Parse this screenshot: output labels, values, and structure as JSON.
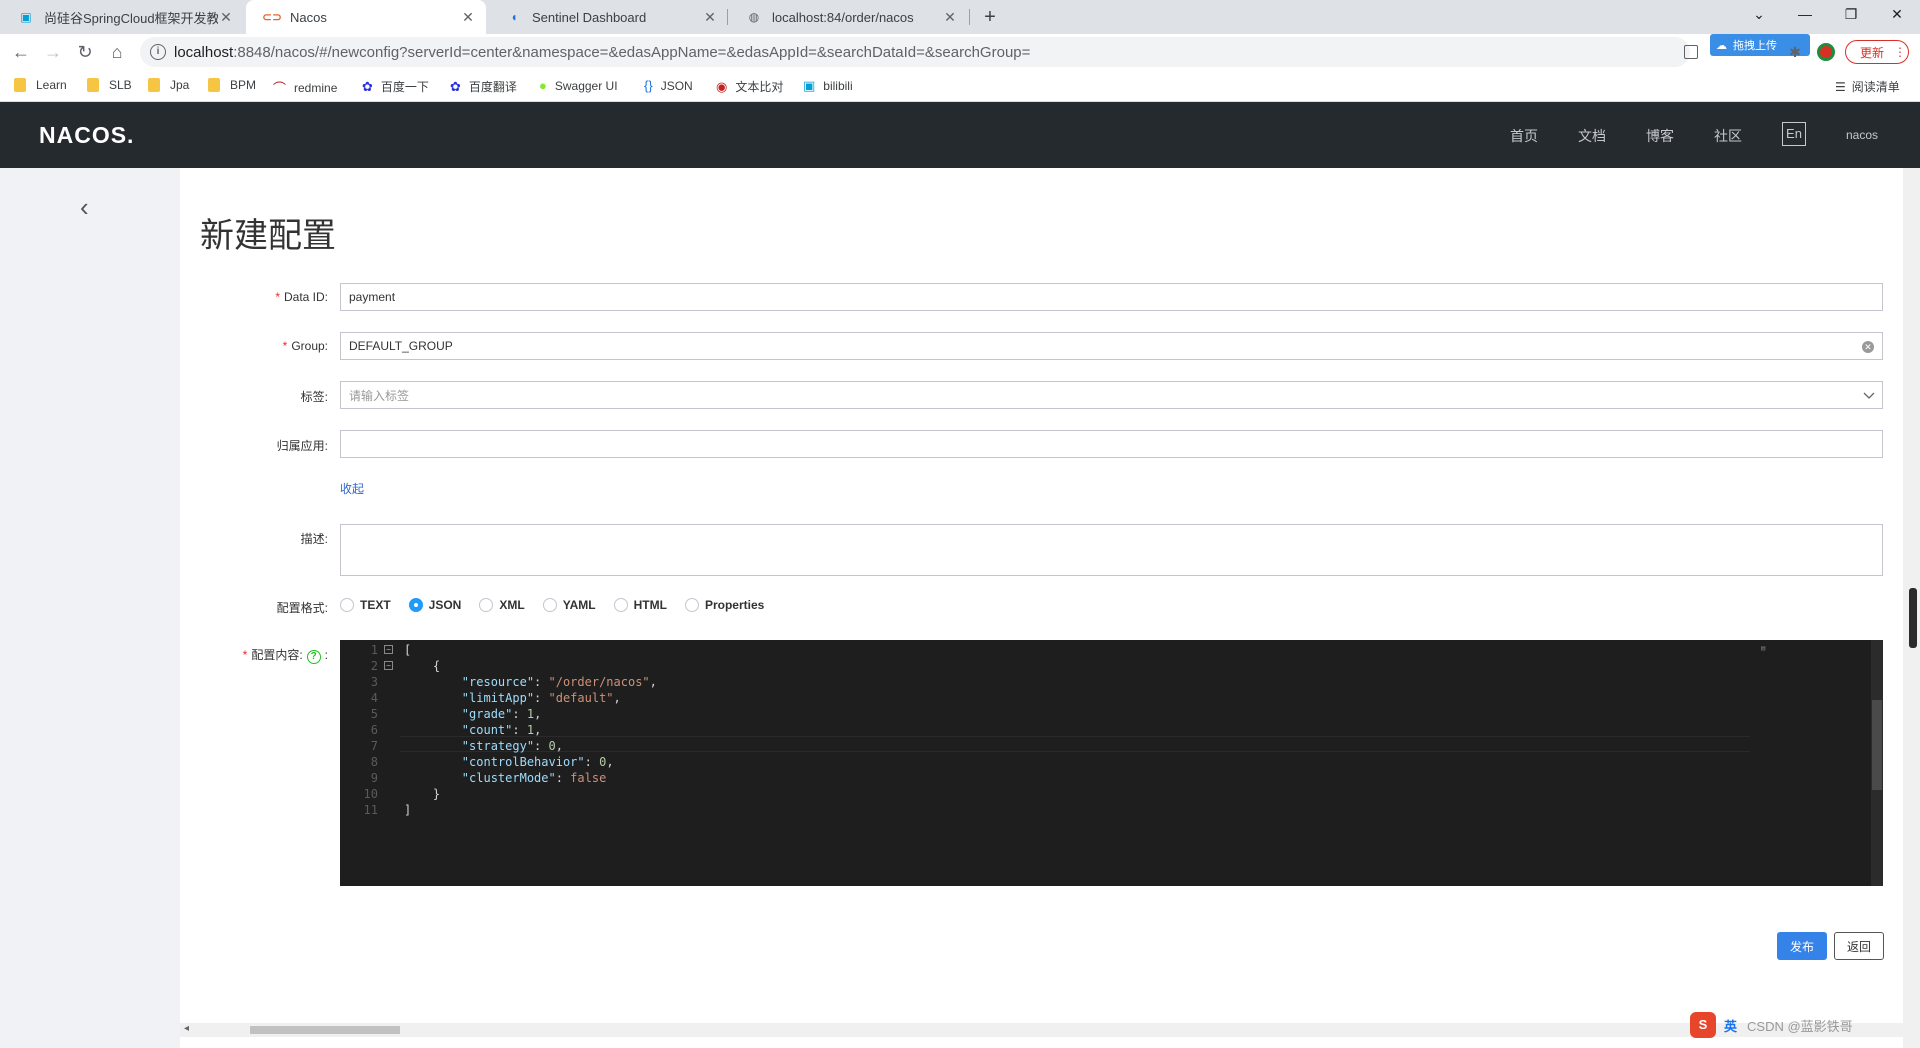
{
  "browser": {
    "tabs": [
      {
        "label": "尚硅谷SpringCloud框架开发教程",
        "icon": "bilibili-icon",
        "active": false
      },
      {
        "label": "Nacos",
        "icon": "nacos-icon",
        "active": true
      },
      {
        "label": "Sentinel Dashboard",
        "icon": "sentinel-icon",
        "active": false
      },
      {
        "label": "localhost:84/order/nacos",
        "icon": "globe-icon",
        "active": false
      }
    ],
    "url_host": "localhost",
    "url_rest": ":8848/nacos/#/newconfig?serverId=center&namespace=&edasAppName=&edasAppId=&searchDataId=&searchGroup=",
    "upload_ext_label": "拖拽上传",
    "update_label": "更新",
    "bookmarks": [
      {
        "label": "Learn",
        "icon": "folder-icon"
      },
      {
        "label": "SLB",
        "icon": "folder-icon"
      },
      {
        "label": "Jpa",
        "icon": "folder-icon"
      },
      {
        "label": "BPM",
        "icon": "folder-icon"
      },
      {
        "label": "redmine",
        "icon": "redmine-icon"
      },
      {
        "label": "百度一下",
        "icon": "baidu-icon"
      },
      {
        "label": "百度翻译",
        "icon": "baidu-icon"
      },
      {
        "label": "Swagger UI",
        "icon": "swagger-icon"
      },
      {
        "label": "JSON",
        "icon": "json-icon"
      },
      {
        "label": "文本比对",
        "icon": "diff-icon"
      },
      {
        "label": "bilibili",
        "icon": "bilibili-icon"
      }
    ],
    "reading_list": "阅读清单"
  },
  "header": {
    "logo": "NACOS.",
    "nav": [
      "首页",
      "文档",
      "博客",
      "社区"
    ],
    "lang": "En",
    "user": "nacos"
  },
  "form": {
    "title": "新建配置",
    "data_id_label": "Data ID:",
    "data_id_value": "payment",
    "group_label": "Group:",
    "group_value": "DEFAULT_GROUP",
    "tags_label": "标签:",
    "tags_placeholder": "请输入标签",
    "app_label": "归属应用:",
    "app_value": "",
    "collapse_link": "收起",
    "desc_label": "描述:",
    "format_label": "配置格式:",
    "formats": [
      "TEXT",
      "JSON",
      "XML",
      "YAML",
      "HTML",
      "Properties"
    ],
    "selected_format": "JSON",
    "content_label": "配置内容:",
    "help_glyph": "?",
    "publish_button": "发布",
    "back_button": "返回"
  },
  "editor": {
    "lines": [
      "[",
      "    {",
      "        \"resource\": \"/order/nacos\",",
      "        \"limitApp\": \"default\",",
      "        \"grade\": 1,",
      "        \"count\": 1,",
      "        \"strategy\": 0,",
      "        \"controlBehavior\": 0,",
      "        \"clusterMode\": false",
      "    }",
      "]"
    ]
  },
  "taskbar": {
    "ime": "S",
    "ime_mode": "英",
    "watermark": "CSDN @蓝影铁哥"
  },
  "colors": {
    "header_bg": "#252a2f",
    "accent": "#3582e9",
    "editor_bg": "#1e1e1e"
  }
}
